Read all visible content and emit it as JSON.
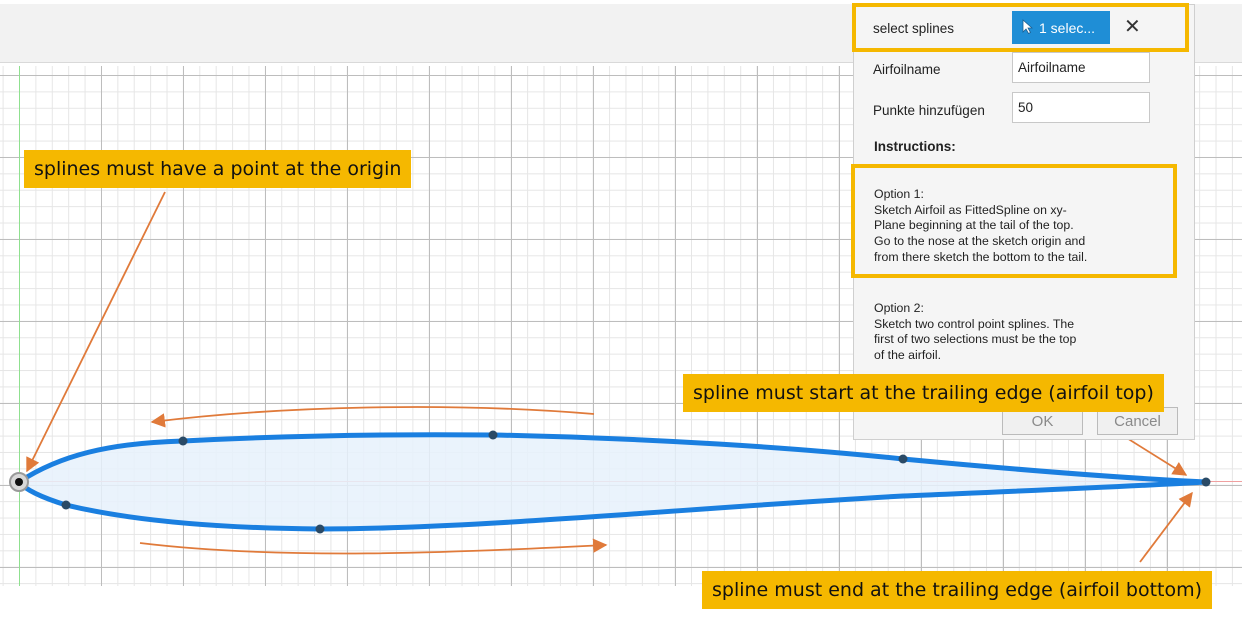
{
  "dialog": {
    "select_splines_label": "select splines",
    "select_button_label": "1 selec...",
    "close_glyph": "✕",
    "airfoilname_label": "Airfoilname",
    "airfoilname_value": "Airfoilname",
    "points_label": "Punkte hinzufügen",
    "points_value": "50",
    "instructions_heading": "Instructions:",
    "option1": [
      "Option 1:",
      "Sketch Airfoil as FittedSpline on xy-",
      "Plane beginning at the tail of the top.",
      "Go to the nose at the sketch origin and",
      "from there sketch the bottom to the tail."
    ],
    "option2": [
      "Option 2:",
      "Sketch two control point splines. The",
      "first of two selections must be the top",
      "of the airfoil."
    ],
    "ok_label": "OK",
    "cancel_label": "Cancel"
  },
  "callouts": {
    "origin": "splines must have a point at the origin",
    "start": "spline must start at the trailing edge (airfoil top)",
    "end": "spline must end at the trailing edge (airfoil bottom)"
  },
  "icons": {
    "cursor": "pointer-cursor-icon",
    "close": "close-icon"
  },
  "colors": {
    "spline": "#1a7fe0",
    "highlight": "#f5b800",
    "arrow": "#e07a3a",
    "select_button": "#1f8ed6"
  }
}
